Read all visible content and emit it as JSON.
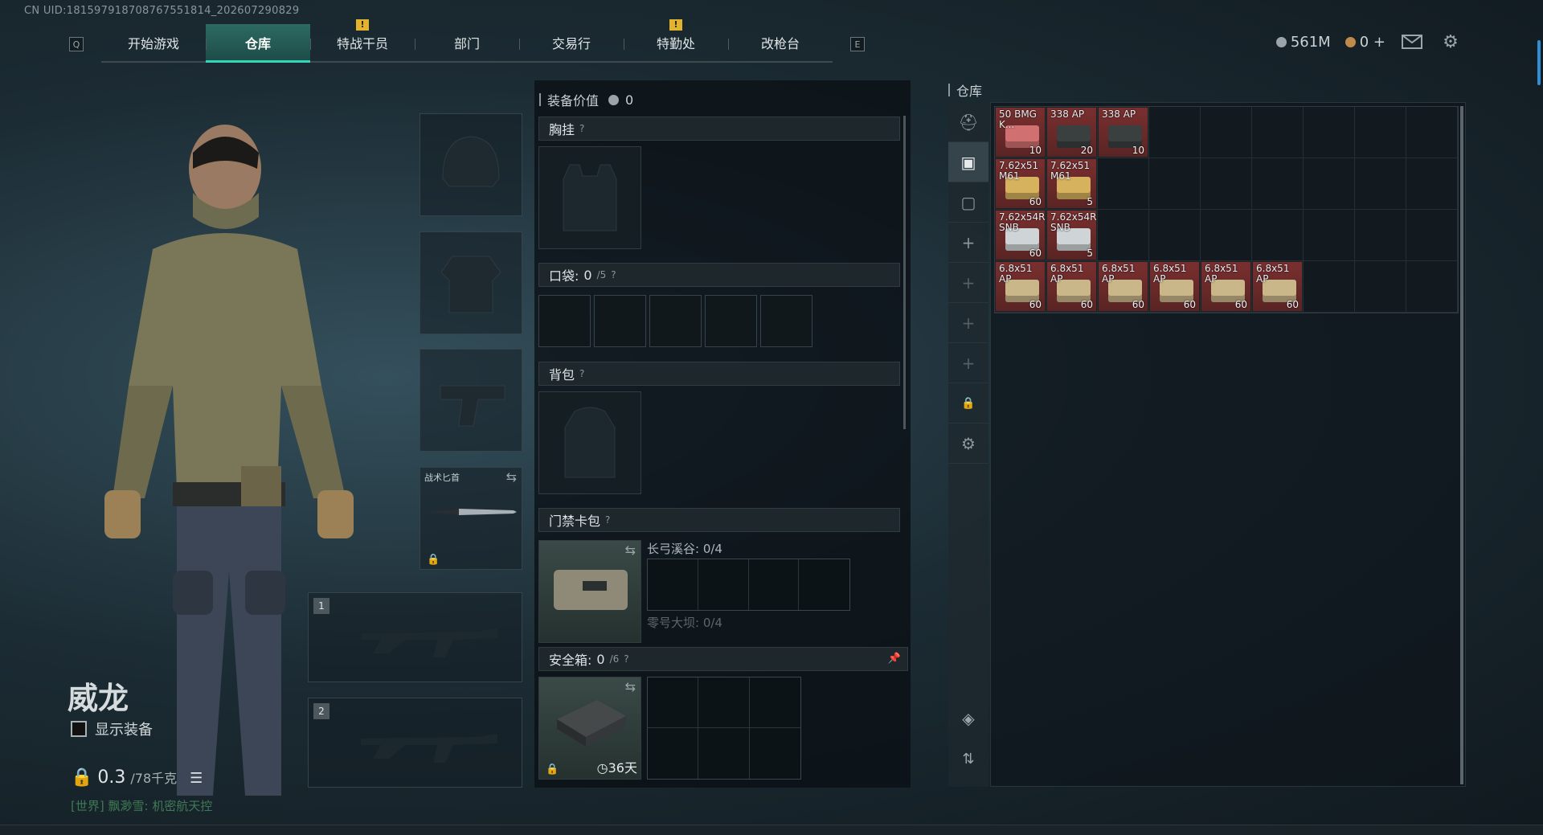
{
  "uid": "CN UID:18159791870876755181​4_202607290829",
  "nav": {
    "key_left": "Q",
    "key_right": "E",
    "tabs": [
      "开始游戏",
      "仓库",
      "特战干员",
      "部门",
      "交易行",
      "特勤处",
      "改枪台"
    ],
    "active_tab": "仓库"
  },
  "currency": {
    "silver": "561M",
    "gold": "0"
  },
  "character": {
    "name": "威龙",
    "show_equipment": "显示装备",
    "weight_value": "0.3",
    "weight_max": "/78千克",
    "chat_channel": "[世界]",
    "chat_text": "飘渺雪: 机密航天控"
  },
  "equipment": {
    "melee_label": "战术匕首",
    "weapon_slot_1": "1",
    "weapon_slot_2": "2"
  },
  "gear": {
    "value_label": "装备价值",
    "value": "0",
    "chest_rig": "胸挂",
    "pockets_label": "口袋:",
    "pockets_used": "0",
    "pockets_total": "/5",
    "backpack": "背包",
    "keycard_label": "门禁卡包",
    "keycard_zone_1": "长弓溪谷: 0/4",
    "keycard_zone_2": "零号大坝: 0/4",
    "safebox_label": "安全箱:",
    "safebox_used": "0",
    "safebox_total": "/6",
    "safebox_timer": "36天",
    "help": "?"
  },
  "warehouse": {
    "title": "仓库",
    "items": [
      {
        "name": "50 BMG K...",
        "count": "10",
        "kind": "red"
      },
      {
        "name": "338 AP",
        "count": "20",
        "kind": "red"
      },
      {
        "name": "338 AP",
        "count": "10",
        "kind": "red"
      },
      {
        "name": "7.62x51 M61",
        "count": "60",
        "kind": "red"
      },
      {
        "name": "7.62x51 M61",
        "count": "5",
        "kind": "red"
      },
      {
        "name": "7.62x54R SNB",
        "count": "60",
        "kind": "red"
      },
      {
        "name": "7.62x54R SNB",
        "count": "5",
        "kind": "red"
      },
      {
        "name": "6.8x51 AP",
        "count": "60",
        "kind": "red"
      },
      {
        "name": "6.8x51 AP",
        "count": "60",
        "kind": "red"
      },
      {
        "name": "6.8x51 AP",
        "count": "60",
        "kind": "red"
      },
      {
        "name": "6.8x51 AP",
        "count": "60",
        "kind": "red"
      },
      {
        "name": "6.8x51 AP",
        "count": "60",
        "kind": "red"
      },
      {
        "name": "6.8x51 AP",
        "count": "60",
        "kind": "red"
      }
    ]
  }
}
